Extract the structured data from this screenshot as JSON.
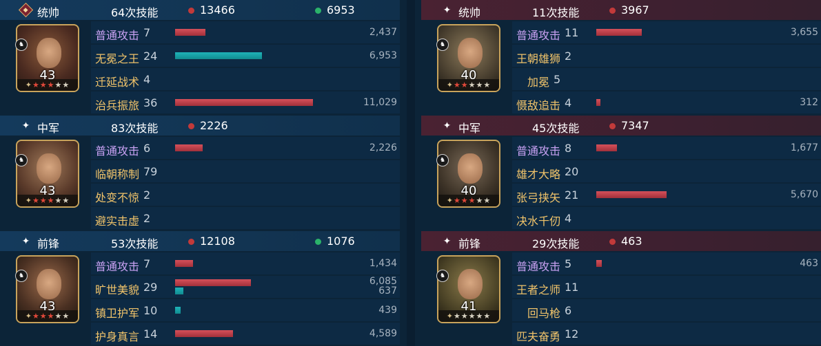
{
  "left_team": {
    "sections": [
      {
        "role": "统帅",
        "casts": "64次技能",
        "damage": "13466",
        "heal": "6953",
        "level": "43",
        "rows": [
          {
            "skill": "普通攻击",
            "count": "7",
            "value": "2,437",
            "bar": 0.22
          },
          {
            "skill": "无冕之王",
            "count": "24",
            "value": "6,953",
            "bar": 0.63,
            "bar_type": "heal"
          },
          {
            "skill": "迁延战术",
            "count": "4",
            "value": ""
          },
          {
            "skill": "治兵振旅",
            "count": "36",
            "value": "11,029",
            "bar": 1.0
          }
        ]
      },
      {
        "role": "中军",
        "casts": "83次技能",
        "damage": "2226",
        "heal": "",
        "level": "43",
        "rows": [
          {
            "skill": "普通攻击",
            "count": "6",
            "value": "2,226",
            "bar": 0.2
          },
          {
            "skill": "临朝称制",
            "count": "79",
            "value": ""
          },
          {
            "skill": "处变不惊",
            "count": "2",
            "value": ""
          },
          {
            "skill": "避实击虚",
            "count": "2",
            "value": ""
          }
        ]
      },
      {
        "role": "前锋",
        "casts": "53次技能",
        "damage": "12108",
        "heal": "1076",
        "level": "43",
        "rows": [
          {
            "skill": "普通攻击",
            "count": "7",
            "value": "1,434",
            "bar": 0.13
          },
          {
            "skill": "旷世美貌",
            "count": "29",
            "value": "6,085",
            "value2": "637",
            "bar": 0.55,
            "bar2": 0.06
          },
          {
            "skill": "镇卫护军",
            "count": "10",
            "value": "439",
            "bar": 0.04,
            "bar_type": "heal"
          },
          {
            "skill": "护身真言",
            "count": "14",
            "value": "4,589",
            "bar": 0.42
          }
        ]
      }
    ]
  },
  "right_team": {
    "sections": [
      {
        "role": "统帅",
        "casts": "11次技能",
        "damage": "3967",
        "level": "40",
        "rows": [
          {
            "skill": "普通攻击",
            "count": "11",
            "value": "3,655",
            "bar": 0.33
          },
          {
            "skill": "王朝雄狮",
            "count": "2",
            "value": ""
          },
          {
            "skill": "加冕",
            "count": "5",
            "value": ""
          },
          {
            "skill": "慑敌追击",
            "count": "4",
            "value": "312",
            "bar": 0.03
          }
        ]
      },
      {
        "role": "中军",
        "casts": "45次技能",
        "damage": "7347",
        "level": "40",
        "rows": [
          {
            "skill": "普通攻击",
            "count": "8",
            "value": "1,677",
            "bar": 0.15
          },
          {
            "skill": "雄才大略",
            "count": "20",
            "value": ""
          },
          {
            "skill": "张弓挟矢",
            "count": "21",
            "value": "5,670",
            "bar": 0.51
          },
          {
            "skill": "决水千仞",
            "count": "4",
            "value": ""
          }
        ]
      },
      {
        "role": "前锋",
        "casts": "29次技能",
        "damage": "463",
        "level": "41",
        "rows": [
          {
            "skill": "普通攻击",
            "count": "5",
            "value": "463",
            "bar": 0.04
          },
          {
            "skill": "王者之师",
            "count": "11",
            "value": ""
          },
          {
            "skill": "回马枪",
            "count": "6",
            "value": ""
          },
          {
            "skill": "匹夫奋勇",
            "count": "12",
            "value": ""
          }
        ]
      }
    ]
  },
  "colors": {
    "damage_dot": "#c23a3a",
    "heal_dot": "#2bb36a",
    "damage_bar": "#c8404a",
    "heal_bar": "#1aa6ab",
    "basic_attack_text": "#c9a2f3",
    "skill_text": "#f0c36a"
  },
  "icons": {
    "commander_marker": "diamond-banner-icon",
    "section_marker": "star-sparkle-icon",
    "damage_marker": "red-dot-icon",
    "heal_marker": "green-dot-icon",
    "unit_badge": "cavalry-icon",
    "rank_star": "star-icon"
  }
}
